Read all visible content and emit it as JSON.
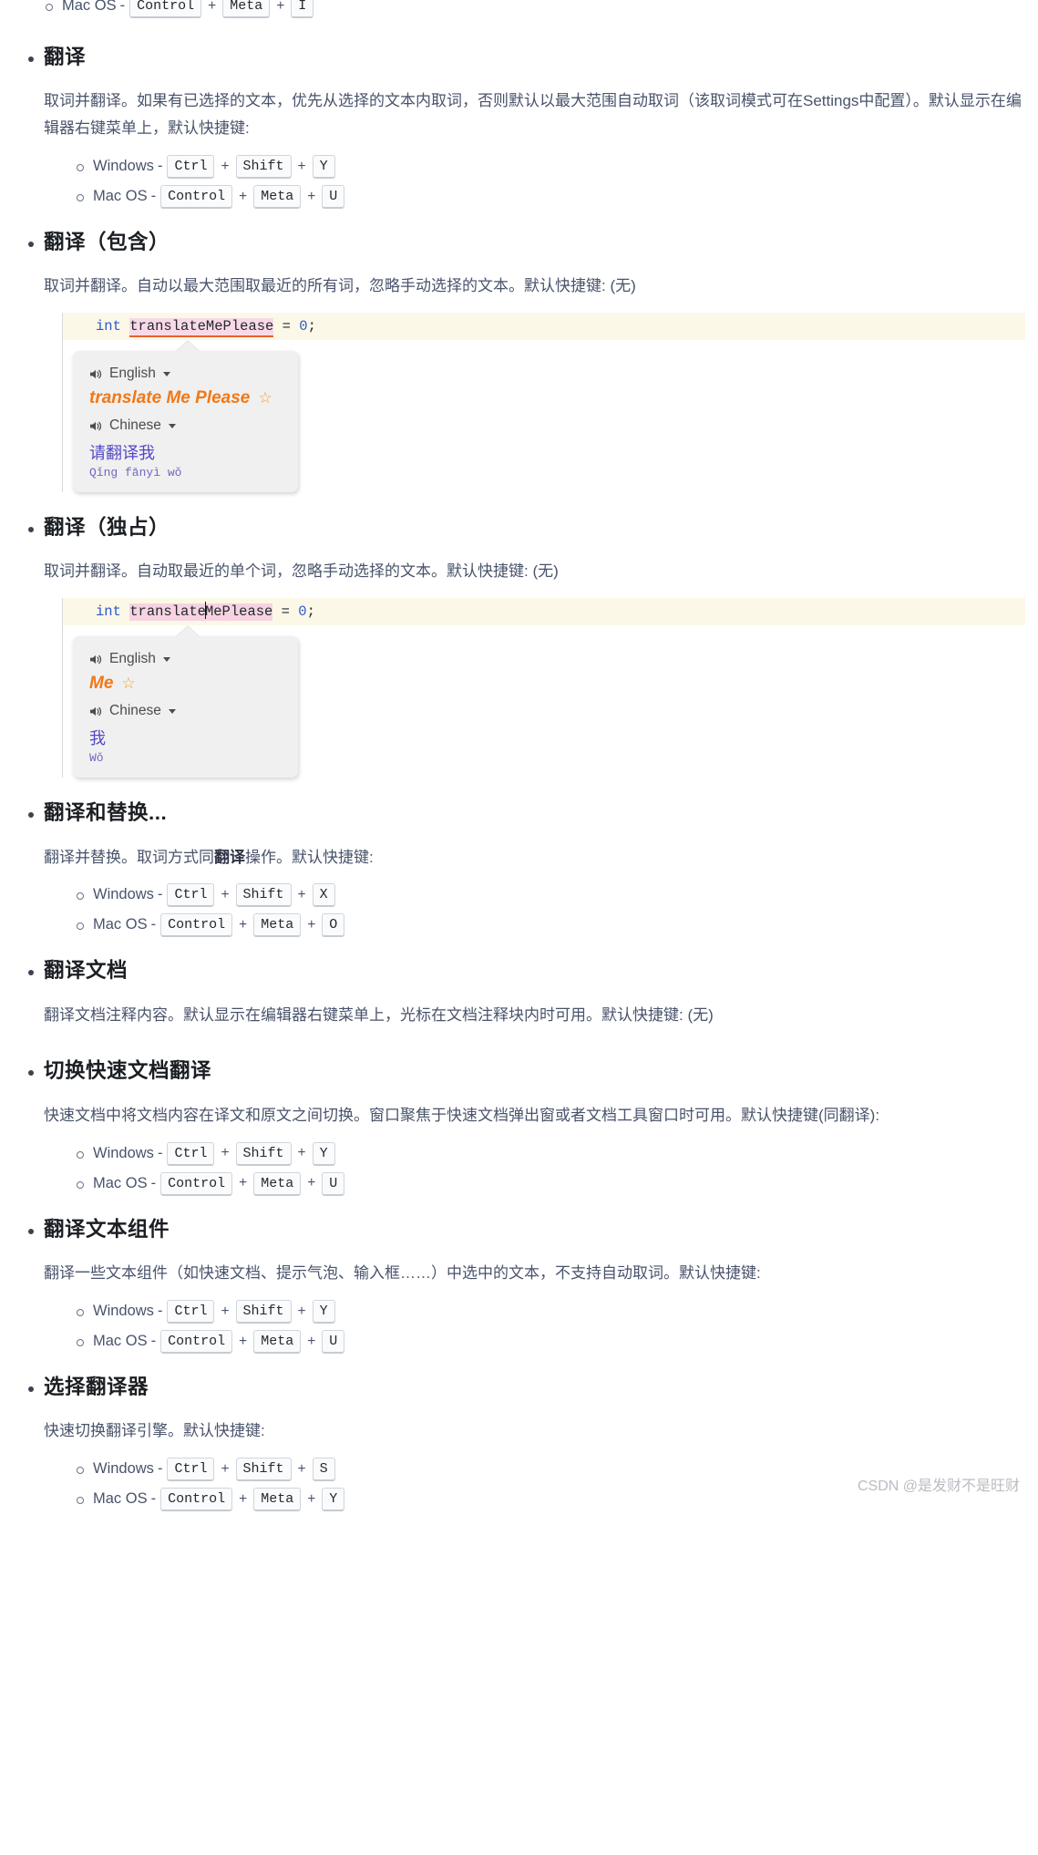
{
  "watermark": "CSDN @是发财不是旺财",
  "clipped_top_row": {
    "os": "Mac OS",
    "dash": "-",
    "keys": [
      "Control",
      "Meta",
      "I"
    ],
    "plus": "+"
  },
  "sections": [
    {
      "title": "翻译",
      "desc": "取词并翻译。如果有已选择的文本，优先从选择的文本内取词，否则默认以最大范围自动取词（该取词模式可在Settings中配置）。默认显示在编辑器右键菜单上，默认快捷键:",
      "shortcuts": [
        {
          "os": "Windows",
          "dash": "-",
          "plus": "+",
          "keys": [
            "Ctrl",
            "Shift",
            "Y"
          ]
        },
        {
          "os": "Mac OS",
          "dash": "-",
          "plus": "+",
          "keys": [
            "Control",
            "Meta",
            "U"
          ]
        }
      ]
    },
    {
      "title": "翻译（包含）",
      "desc": "取词并翻译。自动以最大范围取最近的所有词，忽略手动选择的文本。默认快捷键: (无)",
      "example": {
        "code": {
          "keyword": "int",
          "identifier": "translateMePlease",
          "operator": "=",
          "value": "0",
          "terminator": ";"
        },
        "popup": {
          "source_language": "English",
          "source_text": "translate Me Please",
          "target_language": "Chinese",
          "target_text": "请翻译我",
          "pinyin": "Qǐng fānyì wǒ"
        }
      }
    },
    {
      "title": "翻译（独占）",
      "desc": "取词并翻译。自动取最近的单个词，忽略手动选择的文本。默认快捷键: (无)",
      "example": {
        "code": {
          "keyword": "int",
          "identifier": "translateMePlease",
          "operator": "=",
          "value": "0",
          "terminator": ";"
        },
        "popup": {
          "source_language": "English",
          "source_text": "Me",
          "target_language": "Chinese",
          "target_text": "我",
          "pinyin": "Wǒ"
        }
      }
    },
    {
      "title": "翻译和替换...",
      "desc_pre": "翻译并替换。取词方式同",
      "desc_bold": "翻译",
      "desc_post": "操作。默认快捷键:",
      "shortcuts": [
        {
          "os": "Windows",
          "dash": "-",
          "plus": "+",
          "keys": [
            "Ctrl",
            "Shift",
            "X"
          ]
        },
        {
          "os": "Mac OS",
          "dash": "-",
          "plus": "+",
          "keys": [
            "Control",
            "Meta",
            "O"
          ]
        }
      ]
    },
    {
      "title": "翻译文档",
      "desc": "翻译文档注释内容。默认显示在编辑器右键菜单上，光标在文档注释块内时可用。默认快捷键: (无)"
    },
    {
      "title": "切换快速文档翻译",
      "desc": "快速文档中将文档内容在译文和原文之间切换。窗口聚焦于快速文档弹出窗或者文档工具窗口时可用。默认快捷键(同翻译):",
      "shortcuts": [
        {
          "os": "Windows",
          "dash": "-",
          "plus": "+",
          "keys": [
            "Ctrl",
            "Shift",
            "Y"
          ]
        },
        {
          "os": "Mac OS",
          "dash": "-",
          "plus": "+",
          "keys": [
            "Control",
            "Meta",
            "U"
          ]
        }
      ]
    },
    {
      "title": "翻译文本组件",
      "desc": "翻译一些文本组件（如快速文档、提示气泡、输入框……）中选中的文本，不支持自动取词。默认快捷键:",
      "shortcuts": [
        {
          "os": "Windows",
          "dash": "-",
          "plus": "+",
          "keys": [
            "Ctrl",
            "Shift",
            "Y"
          ]
        },
        {
          "os": "Mac OS",
          "dash": "-",
          "plus": "+",
          "keys": [
            "Control",
            "Meta",
            "U"
          ]
        }
      ]
    },
    {
      "title": "选择翻译器",
      "desc": "快速切换翻译引擎。默认快捷键:",
      "shortcuts": [
        {
          "os": "Windows",
          "dash": "-",
          "plus": "+",
          "keys": [
            "Ctrl",
            "Shift",
            "S"
          ]
        },
        {
          "os": "Mac OS",
          "dash": "-",
          "plus": "+",
          "keys": [
            "Control",
            "Meta",
            "Y"
          ]
        }
      ]
    }
  ]
}
